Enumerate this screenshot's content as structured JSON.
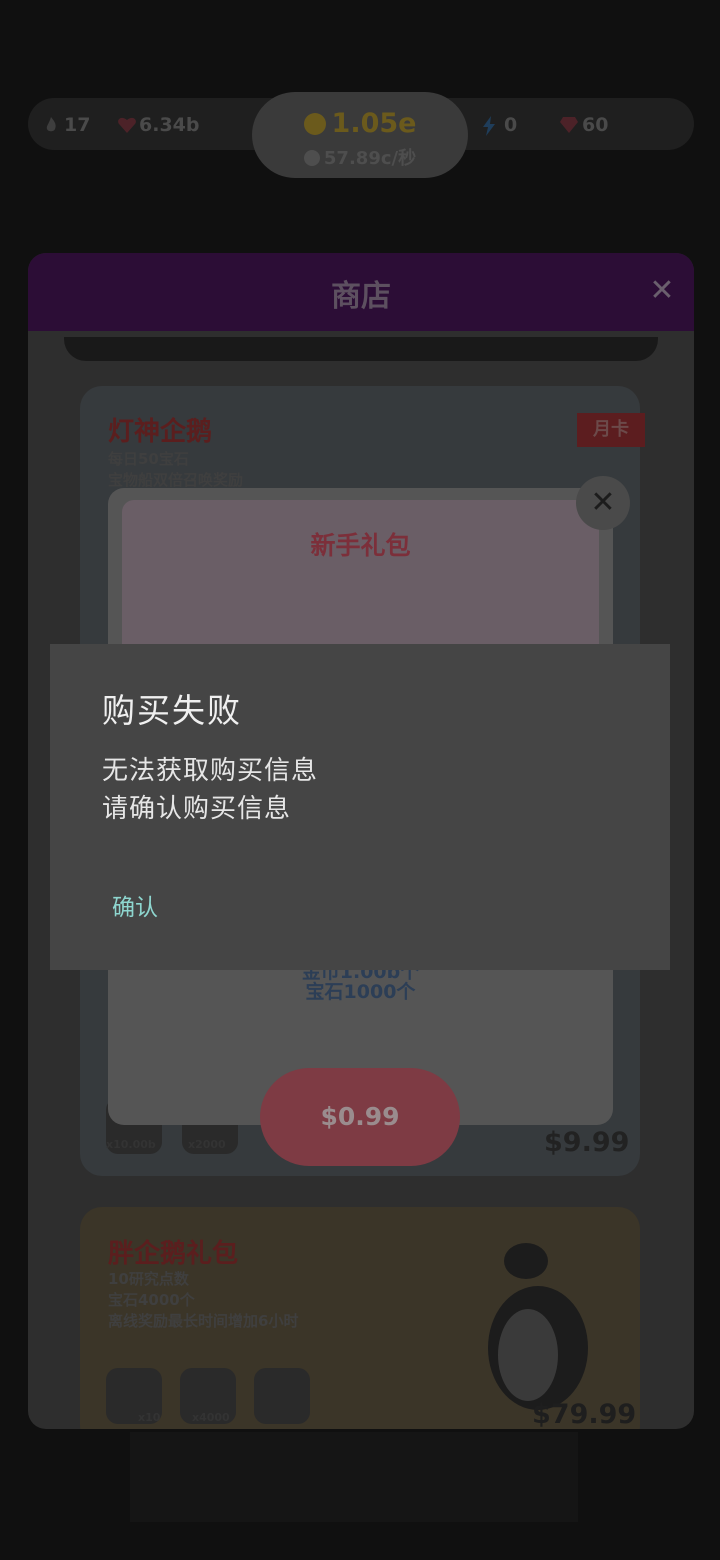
{
  "topbar": {
    "stats": [
      {
        "icon": "flame-icon",
        "value": "17"
      },
      {
        "icon": "heart-icon",
        "value": "6.34b"
      },
      {
        "icon": "lightning-icon",
        "value": "0"
      },
      {
        "icon": "gem-icon",
        "value": "60"
      }
    ],
    "coins": {
      "total": "1.05e",
      "rate": "57.89c/秒"
    }
  },
  "shop": {
    "title": "商店",
    "close_icon": "close-icon",
    "card1": {
      "title": "灯神企鹅",
      "lines": [
        "每日50宝石",
        "宝物船双倍召唤奖励"
      ],
      "badge": "月卡",
      "items": [
        "x10.00b",
        "x2000"
      ],
      "price": "$9.99"
    },
    "card2": {
      "title": "胖企鹅礼包",
      "lines": [
        "10研究点数",
        "宝石4000个",
        "离线奖励最长时间增加6小时"
      ],
      "items": [
        "x10",
        "x4000",
        ""
      ],
      "price": "$79.99"
    }
  },
  "pack_popup": {
    "title": "新手礼包",
    "lines": [
      "金币1.00b个",
      "宝石1000个"
    ],
    "buy_label": "$0.99"
  },
  "dialog": {
    "title": "购买失败",
    "message_line1": "无法获取购买信息",
    "message_line2": "请确认购买信息",
    "confirm_label": "确认"
  },
  "colors": {
    "dialog_bg": "#454545",
    "confirm_text": "#8ed6cf",
    "overlay_dim": "#101010"
  }
}
